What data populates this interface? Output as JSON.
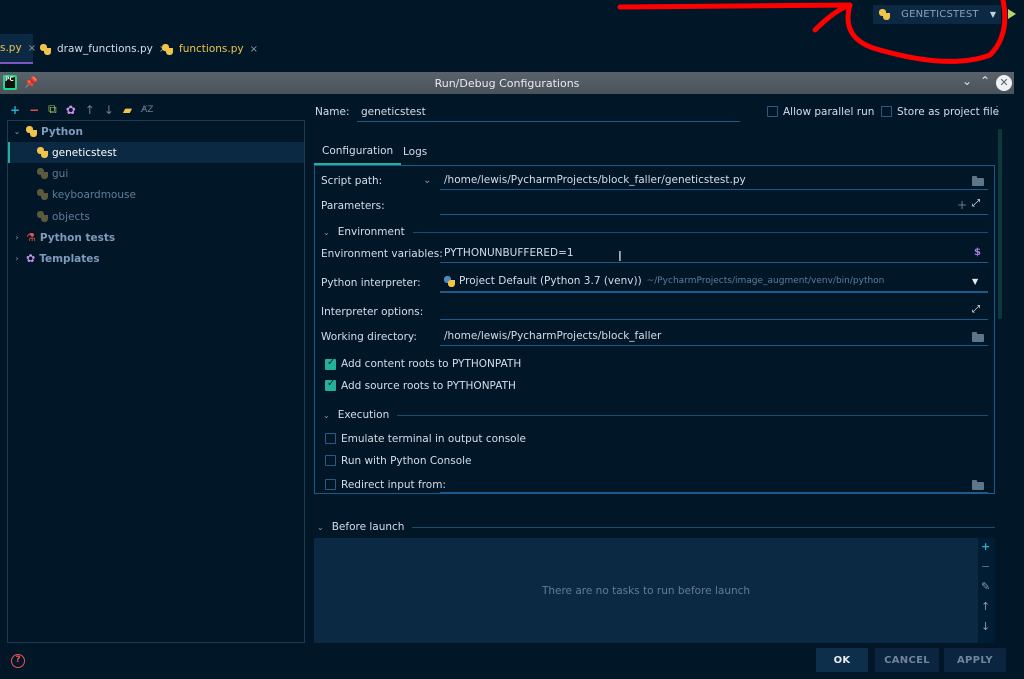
{
  "editor": {
    "tabs": [
      {
        "label": "s.py",
        "active": true
      },
      {
        "label": "draw_functions.py",
        "active": false
      },
      {
        "label": "functions.py",
        "active": false
      }
    ],
    "run_config_selector": "GENETICSTEST"
  },
  "dialog": {
    "title": "Run/Debug Configurations",
    "tree": {
      "items": [
        {
          "label": "Python",
          "level": 0,
          "expanded": true
        },
        {
          "label": "geneticstest",
          "level": 1,
          "selected": true
        },
        {
          "label": "gui",
          "level": 1
        },
        {
          "label": "keyboardmouse",
          "level": 1
        },
        {
          "label": "objects",
          "level": 1
        },
        {
          "label": "Python tests",
          "level": 0,
          "expanded": false
        },
        {
          "label": "Templates",
          "level": 0,
          "expanded": false
        }
      ]
    },
    "name_label": "Name:",
    "name_value": "geneticstest",
    "allow_parallel_run": {
      "label": "Allow parallel run",
      "checked": false
    },
    "store_as_project_file": {
      "label": "Store as project file",
      "checked": false
    },
    "tabs": {
      "configuration": "Configuration",
      "logs": "Logs"
    },
    "config": {
      "script_path_label": "Script path:",
      "script_path_value": "/home/lewis/PycharmProjects/block_faller/geneticstest.py",
      "parameters_label": "Parameters:",
      "parameters_value": "",
      "environment_section": "Environment",
      "env_vars_label": "Environment variables:",
      "env_vars_value": "PYTHONUNBUFFERED=1",
      "interpreter_label": "Python interpreter:",
      "interpreter_value": "Project Default (Python 3.7 (venv))",
      "interpreter_path": "~/PycharmProjects/image_augment/venv/bin/python",
      "interpreter_options_label": "Interpreter options:",
      "interpreter_options_value": "",
      "working_dir_label": "Working directory:",
      "working_dir_value": "/home/lewis/PycharmProjects/block_faller",
      "add_content_roots": {
        "label": "Add content roots to PYTHONPATH",
        "checked": true
      },
      "add_source_roots": {
        "label": "Add source roots to PYTHONPATH",
        "checked": true
      },
      "execution_section": "Execution",
      "emulate_terminal": {
        "label": "Emulate terminal in output console",
        "checked": false
      },
      "run_with_console": {
        "label": "Run with Python Console",
        "checked": false
      },
      "redirect_input": {
        "label": "Redirect input from:",
        "checked": false,
        "value": ""
      }
    },
    "before_launch": {
      "section": "Before launch",
      "empty_message": "There are no tasks to run before launch"
    },
    "buttons": {
      "ok": "OK",
      "cancel": "CANCEL",
      "apply": "APPLY"
    }
  },
  "colors": {
    "background": "#011627",
    "accent_teal": "#23b19b",
    "field_underline": "#1d5a8c",
    "annotation_red": "#ff0000"
  }
}
